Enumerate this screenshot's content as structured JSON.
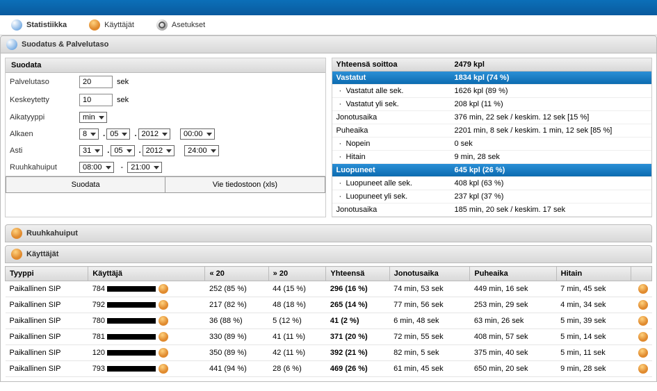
{
  "tabs": {
    "stats": "Statistiikka",
    "users": "Käyttäjät",
    "settings": "Asetukset"
  },
  "filter_panel_title": "Suodatus & Palvelutaso",
  "filter_title": "Suodata",
  "form": {
    "palvelutaso_label": "Palvelutaso",
    "palvelutaso_value": "20",
    "sek": "sek",
    "keskeytetty_label": "Keskeytetty",
    "keskeytetty_value": "10",
    "aikatyyppi_label": "Aikatyyppi",
    "aikatyyppi_value": "min",
    "alkaen_label": "Alkaen",
    "alkaen_day": "8",
    "alkaen_month": "05",
    "alkaen_year": "2012",
    "alkaen_time": "00:00",
    "asti_label": "Asti",
    "asti_day": "31",
    "asti_month": "05",
    "asti_year": "2012",
    "asti_time": "24:00",
    "ruuhka_label": "Ruuhkahuiput",
    "ruuhka_from": "08:00",
    "ruuhka_to": "21:00",
    "dash": "-",
    "btn_filter": "Suodata",
    "btn_export": "Vie tiedostoon (xls)"
  },
  "stats": {
    "total_label": "Yhteensä soittoa",
    "total_val": "2479 kpl",
    "answered_label": "Vastatut",
    "answered_val": "1834 kpl (74 %)",
    "answered_under_label": "Vastatut alle sek.",
    "answered_under_val": "1626 kpl (89 %)",
    "answered_over_label": "Vastatut yli sek.",
    "answered_over_val": "208 kpl (11 %)",
    "queue_label": "Jonotusaika",
    "queue_val": "376 min, 22 sek / keskim. 12 sek [15 %]",
    "talk_label": "Puheaika",
    "talk_val": "2201 min, 8 sek / keskim. 1 min, 12 sek [85 %]",
    "fastest_label": "Nopein",
    "fastest_val": "0 sek",
    "slowest_label": "Hitain",
    "slowest_val": "9 min, 28 sek",
    "abandoned_label": "Luopuneet",
    "abandoned_val": "645 kpl (26 %)",
    "abandoned_under_label": "Luopuneet alle sek.",
    "abandoned_under_val": "408 kpl (63 %)",
    "abandoned_over_label": "Luopuneet yli sek.",
    "abandoned_over_val": "237 kpl (37 %)",
    "abandon_queue_label": "Jonotusaika",
    "abandon_queue_val": "185 min, 20 sek / keskim. 17 sek"
  },
  "ruuhka_panel": "Ruuhkahuiput",
  "users_panel": "Käyttäjät",
  "table": {
    "h_type": "Tyyppi",
    "h_user": "Käyttäjä",
    "h_under": "« 20",
    "h_over": "» 20",
    "h_total": "Yhteensä",
    "h_queue": "Jonotusaika",
    "h_talk": "Puheaika",
    "h_slow": "Hitain",
    "rows": [
      {
        "type": "Paikallinen SIP",
        "user": "784",
        "under": "252 (85 %)",
        "over": "44 (15 %)",
        "total": "296 (16 %)",
        "queue": "74 min, 53 sek",
        "talk": "449 min, 16 sek",
        "slow": "7 min, 45 sek"
      },
      {
        "type": "Paikallinen SIP",
        "user": "792",
        "under": "217 (82 %)",
        "over": "48 (18 %)",
        "total": "265 (14 %)",
        "queue": "77 min, 56 sek",
        "talk": "253 min, 29 sek",
        "slow": "4 min, 34 sek"
      },
      {
        "type": "Paikallinen SIP",
        "user": "780",
        "under": "36 (88 %)",
        "over": "5 (12 %)",
        "total": "41 (2 %)",
        "queue": "6 min, 48 sek",
        "talk": "63 min, 26 sek",
        "slow": "5 min, 39 sek"
      },
      {
        "type": "Paikallinen SIP",
        "user": "781",
        "under": "330 (89 %)",
        "over": "41 (11 %)",
        "total": "371 (20 %)",
        "queue": "72 min, 55 sek",
        "talk": "408 min, 57 sek",
        "slow": "5 min, 14 sek"
      },
      {
        "type": "Paikallinen SIP",
        "user": "120",
        "under": "350 (89 %)",
        "over": "42 (11 %)",
        "total": "392 (21 %)",
        "queue": "82 min, 5 sek",
        "talk": "375 min, 40 sek",
        "slow": "5 min, 11 sek"
      },
      {
        "type": "Paikallinen SIP",
        "user": "793",
        "under": "441 (94 %)",
        "over": "28 (6 %)",
        "total": "469 (26 %)",
        "queue": "61 min, 45 sek",
        "talk": "650 min, 20 sek",
        "slow": "9 min, 28 sek"
      }
    ]
  }
}
